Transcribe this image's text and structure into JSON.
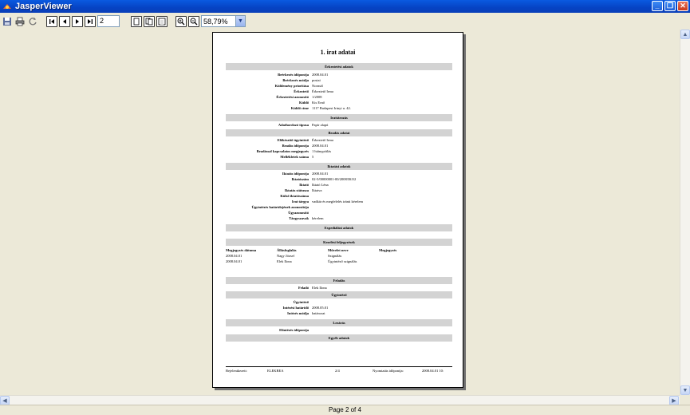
{
  "window": {
    "title": "JasperViewer"
  },
  "toolbar": {
    "page_number": "2",
    "zoom": "58,79%"
  },
  "status": {
    "page_info": "Page 2 of 4"
  },
  "report": {
    "title": "1. irat adatai",
    "sections": {
      "s1": "Érkeztetési adatok",
      "s2": "Irattározás",
      "s3": "Beadás adatai",
      "s4": "Iktatási adatok",
      "s5": "Expediálási adatok",
      "s6": "Kezelési feljegyzések",
      "s7": "Feladás",
      "s8": "Ügyintéző",
      "s9": "Lezárás",
      "s10": "Egyéb adatok"
    },
    "erkeztetes": [
      {
        "label": "Beérkezés időpontja",
        "value": "2008.04.01"
      },
      {
        "label": "Beérkezés módja",
        "value": "postai"
      },
      {
        "label": "Küldemény prioritása",
        "value": "Normál"
      },
      {
        "label": "Érkeztető",
        "value": "Érkeztető Irma"
      },
      {
        "label": "Érkeztetési azonosító",
        "value": "1/2008"
      },
      {
        "label": "Küldő",
        "value": "Kis Ernő"
      },
      {
        "label": "Küldő címe",
        "value": "1117 Budapest Irinyi u. 42."
      }
    ],
    "irattarozas": [
      {
        "label": "Adathordozó típusa",
        "value": "Papír alapú"
      }
    ],
    "beadas": [
      {
        "label": "Előkészítő ügyintéző",
        "value": "Érkeztető Irma"
      },
      {
        "label": "Beadás időpontja",
        "value": "2008.04.01"
      },
      {
        "label": "Beadással kapcsolatos megjegyzés",
        "value": "1 hiánypótlás"
      },
      {
        "label": "Mellékletek száma",
        "value": "5"
      }
    ],
    "iktatas": [
      {
        "label": "Iktatás időpontja",
        "value": "2008.04.01"
      },
      {
        "label": "Iktatószám",
        "value": "02-5/00000001-00/2008/IKO2"
      },
      {
        "label": "Iktató",
        "value": "Iktató Léna"
      },
      {
        "label": "Iktatás státusza",
        "value": "Iktatva"
      },
      {
        "label": "Külső iktatószáma",
        "value": ""
      },
      {
        "label": "Irat tárgya",
        "value": "vadkár és megfelelés iránti kérelem"
      },
      {
        "label": "Ügyintézés határidejének azonosítója",
        "value": ""
      },
      {
        "label": "Ügyazonosító",
        "value": ""
      },
      {
        "label": "Tárgyszavak",
        "value": "kérelem"
      }
    ],
    "kezelesi_headers": [
      "Megjegyzés dátuma",
      "Állásfoglalás",
      "Művelet neve",
      "Megjegyzés"
    ],
    "kezelesi_rows": [
      [
        "2008.04.01",
        "Nagy József",
        "Szignálás",
        ""
      ],
      [
        "2008.04.01",
        "Elek Ilona",
        "Ügyintéző szignálás",
        ""
      ]
    ],
    "feladas": [
      {
        "label": "Feladó",
        "value": "Elek Ilona"
      }
    ],
    "ugyintezo": [
      {
        "label": "Ügyintéző",
        "value": ""
      },
      {
        "label": "Intézési határidő",
        "value": "2008.05.01"
      },
      {
        "label": "Intézés módja",
        "value": "határozat"
      }
    ],
    "lezaras": [
      {
        "label": "Elintézés időpontja",
        "value": ""
      }
    ],
    "footer": {
      "left_label": "Bejelentkezett:",
      "left_value": "ELEKBEA",
      "page": "2/4",
      "right_label": "Nyomtatás időpontja:",
      "right_value": "2008.04.01 10:"
    }
  }
}
